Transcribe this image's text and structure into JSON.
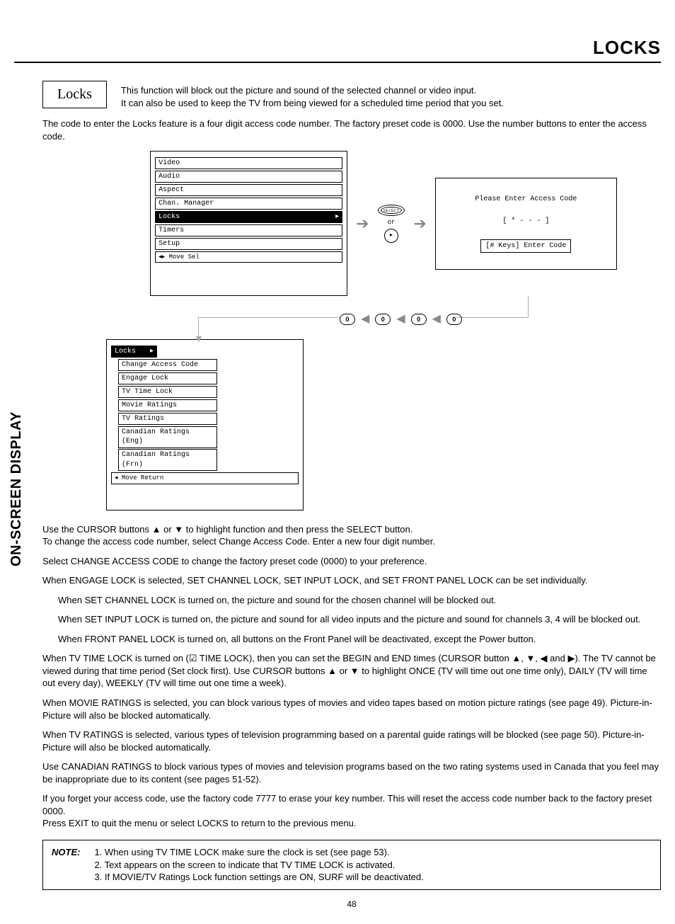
{
  "header": {
    "title": "LOCKS"
  },
  "sideTab": "ON-SCREEN DISPLAY",
  "intro": {
    "boxLabel": "Locks",
    "line1": "This function will block out the picture and sound of the selected channel or video input.",
    "line2": "It can also be used to keep the TV from being viewed for a scheduled time period that you set."
  },
  "preamble": "The code to enter the Locks feature is a four digit access code number.  The factory preset code is 0000. Use the number buttons to enter the access code.",
  "osd1": {
    "items": [
      "Video",
      "Audio",
      "Aspect",
      "Chan. Manager",
      "Locks",
      "Timers",
      "Setup"
    ],
    "selectedIndex": 4,
    "footer": "  Move     Sel"
  },
  "remote": {
    "select": "SELECT",
    "or": "or",
    "play": "▸"
  },
  "access": {
    "l1": "Please Enter Access Code",
    "l2": "[ * - - - ]",
    "l3": "[# Keys] Enter Code"
  },
  "keys": [
    "0",
    "0",
    "0",
    "0"
  ],
  "osd2": {
    "header": "Locks",
    "items": [
      "Change Access Code",
      "Engage Lock",
      "TV Time Lock",
      "Movie Ratings",
      "TV Ratings",
      "Canadian Ratings (Eng)",
      "Canadian Ratings (Frn)"
    ],
    "footer": "  Move     Return"
  },
  "body": {
    "p1a": "Use the CURSOR buttons ▲ or ▼ to highlight function and then press the SELECT button.",
    "p1b": "To change the access code number, select Change Access Code.  Enter a new four digit number.",
    "p2": "Select CHANGE ACCESS CODE to change the factory preset code (0000) to your preference.",
    "p3": "When ENGAGE LOCK is selected, SET CHANNEL LOCK, SET INPUT LOCK, and SET FRONT PANEL LOCK can be set individually.",
    "p3a": "When SET CHANNEL LOCK is turned on, the picture and sound for the chosen channel will be blocked out.",
    "p3b": "When SET INPUT LOCK is turned on, the picture and sound for all video inputs and the picture and sound for channels 3, 4 will be blocked out.",
    "p3c": "When FRONT PANEL LOCK is turned on, all buttons on the Front Panel will be deactivated, except the Power button.",
    "p4": "When TV TIME LOCK is turned on (☑ TIME LOCK), then you can set the BEGIN and END times (CURSOR button ▲, ▼, ◀ and ▶). The TV cannot be viewed during that time period (Set clock first). Use CURSOR buttons ▲ or ▼ to highlight ONCE (TV will time out one time only), DAILY (TV will time out every day), WEEKLY (TV will time out one time a week).",
    "p5": "When MOVIE RATINGS is selected, you can block various types of movies and video tapes based on motion picture ratings (see page 49). Picture-in-Picture will also be blocked automatically.",
    "p6": "When TV RATINGS is selected, various types of television programming based on a parental guide ratings will be blocked (see page 50). Picture-in-Picture will also be blocked automatically.",
    "p7": "Use CANADIAN RATINGS to block various types of movies and television programs based on the two rating systems used in Canada that you feel may be inappropriate due to its content (see pages 51-52).",
    "p8": "If you forget your access code, use the factory code 7777 to erase your key number. This will reset the access code number back to the factory preset 0000.",
    "p9": "Press EXIT to quit the menu or select LOCKS to return to the previous menu."
  },
  "note": {
    "label": "NOTE:",
    "n1": "1. When using TV TIME LOCK make sure the clock is set (see page 53).",
    "n2": "2. Text appears on the screen to indicate that TV TIME LOCK is activated.",
    "n3": "3. If MOVIE/TV Ratings Lock function settings are ON, SURF will be deactivated."
  },
  "pageNum": "48"
}
